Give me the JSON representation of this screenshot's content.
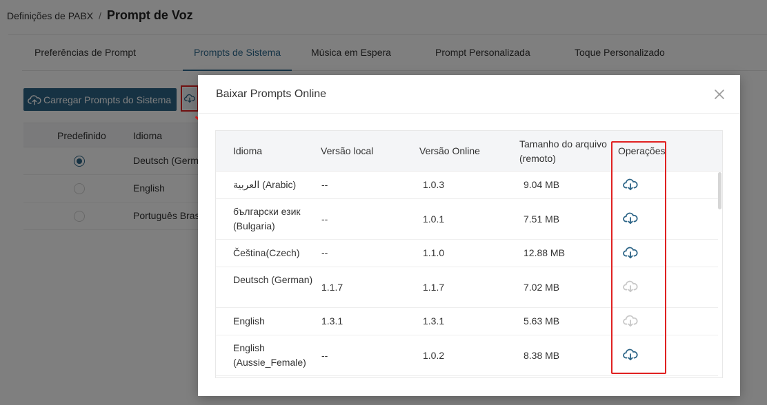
{
  "breadcrumb": {
    "parent": "Definições de PABX",
    "separator": "/",
    "current": "Prompt de Voz"
  },
  "tabs": [
    {
      "label": "Preferências de Prompt"
    },
    {
      "label": "Prompts de Sistema",
      "active": true
    },
    {
      "label": "Música em Espera"
    },
    {
      "label": "Prompt Personalizada"
    },
    {
      "label": "Toque Personalizado"
    }
  ],
  "toolbar": {
    "upload_label": "Carregar Prompts do Sistema",
    "upload_icon": "cloud-upload-icon",
    "download_icon": "cloud-download-icon"
  },
  "background_table": {
    "headers": {
      "default": "Predefinido",
      "language": "Idioma"
    },
    "rows": [
      {
        "selected": true,
        "language": "Deutsch (German)"
      },
      {
        "selected": false,
        "language": "English"
      },
      {
        "selected": false,
        "language": "Português Brasil"
      }
    ]
  },
  "modal": {
    "title": "Baixar Prompts Online",
    "close_icon": "close-icon",
    "headers": {
      "language": "Idioma",
      "local_version": "Versão local",
      "online_version": "Versão Online",
      "file_size": "Tamanho do arquivo (remoto)",
      "operations": "Operações"
    },
    "rows": [
      {
        "language": "العربية (Arabic)",
        "local_version": "--",
        "online_version": "1.0.3",
        "file_size": "9.04 MB",
        "download_enabled": true
      },
      {
        "language": "български език (Bulgaria)",
        "local_version": "--",
        "online_version": "1.0.1",
        "file_size": "7.51 MB",
        "download_enabled": true
      },
      {
        "language": "Čeština(Czech)",
        "local_version": "--",
        "online_version": "1.1.0",
        "file_size": "12.88 MB",
        "download_enabled": true
      },
      {
        "language": "Deutsch (German)",
        "local_version": "1.1.7",
        "online_version": "1.1.7",
        "file_size": "7.02 MB",
        "download_enabled": false
      },
      {
        "language": "English",
        "local_version": "1.3.1",
        "online_version": "1.3.1",
        "file_size": "5.63 MB",
        "download_enabled": false
      },
      {
        "language": "English (Aussie_Female)",
        "local_version": "--",
        "online_version": "1.0.2",
        "file_size": "8.38 MB",
        "download_enabled": true
      }
    ]
  },
  "colors": {
    "accent": "#2d6587",
    "download_enabled": "#2d6587",
    "download_disabled": "#c8c8c8",
    "highlight": "#e02020"
  }
}
